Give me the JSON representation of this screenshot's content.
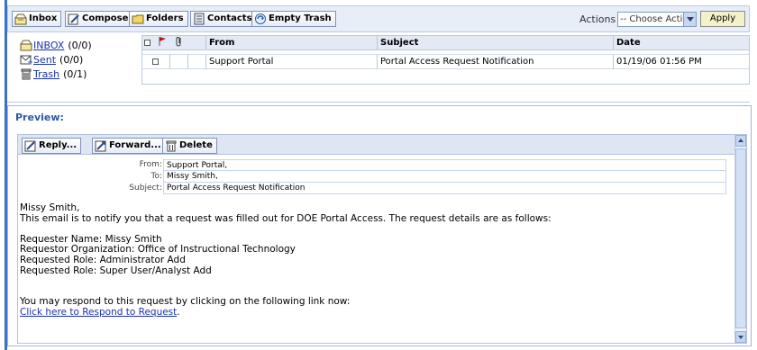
{
  "toolbar": {
    "inbox_label": "Inbox",
    "compose_label": "Compose",
    "folders_label": "Folders",
    "contacts_label": "Contacts",
    "empty_trash_label": "Empty Trash",
    "actions_label": "Actions",
    "actions_selected": "-- Choose Action --",
    "apply_label": "Apply"
  },
  "folders": [
    {
      "name": "INBOX",
      "count": "(0/0)"
    },
    {
      "name": "Sent",
      "count": "(0/0)"
    },
    {
      "name": "Trash",
      "count": "(0/1)"
    }
  ],
  "message_list": {
    "columns": {
      "from": "From",
      "subject": "Subject",
      "date": "Date"
    },
    "rows": [
      {
        "from": "Support Portal",
        "subject": "Portal Access Request Notification",
        "date": "01/19/06 01:56 PM"
      }
    ]
  },
  "preview": {
    "title": "Preview:",
    "reply_label": "Reply...",
    "forward_label": "Forward...",
    "delete_label": "Delete",
    "headers": {
      "from_label": "From:",
      "from_value": "Support Portal,",
      "to_label": "To:",
      "to_value": "Missy Smith,",
      "subject_label": "Subject:",
      "subject_value": "Portal Access Request Notification"
    },
    "body": {
      "greeting": "Missy Smith,",
      "intro": "This email is to notify you that a request was filled out for DOE Portal Access. The request details are as follows:",
      "requester_name": "Requester Name: Missy Smith",
      "requester_org": "Requestor Organization: Office of Instructional Technology",
      "role1": "Requested Role: Administrator Add",
      "role2": "Requested Role: Super User/Analyst Add",
      "respond_text": "You may respond to this request by clicking on the following link now:",
      "respond_link": "Click here to Respond to Request"
    }
  },
  "colors": {
    "accent": "#3a72c6",
    "toolbar_bg": "#e8eef8",
    "link": "#1a33aa",
    "preview_title": "#2d5aa8"
  }
}
